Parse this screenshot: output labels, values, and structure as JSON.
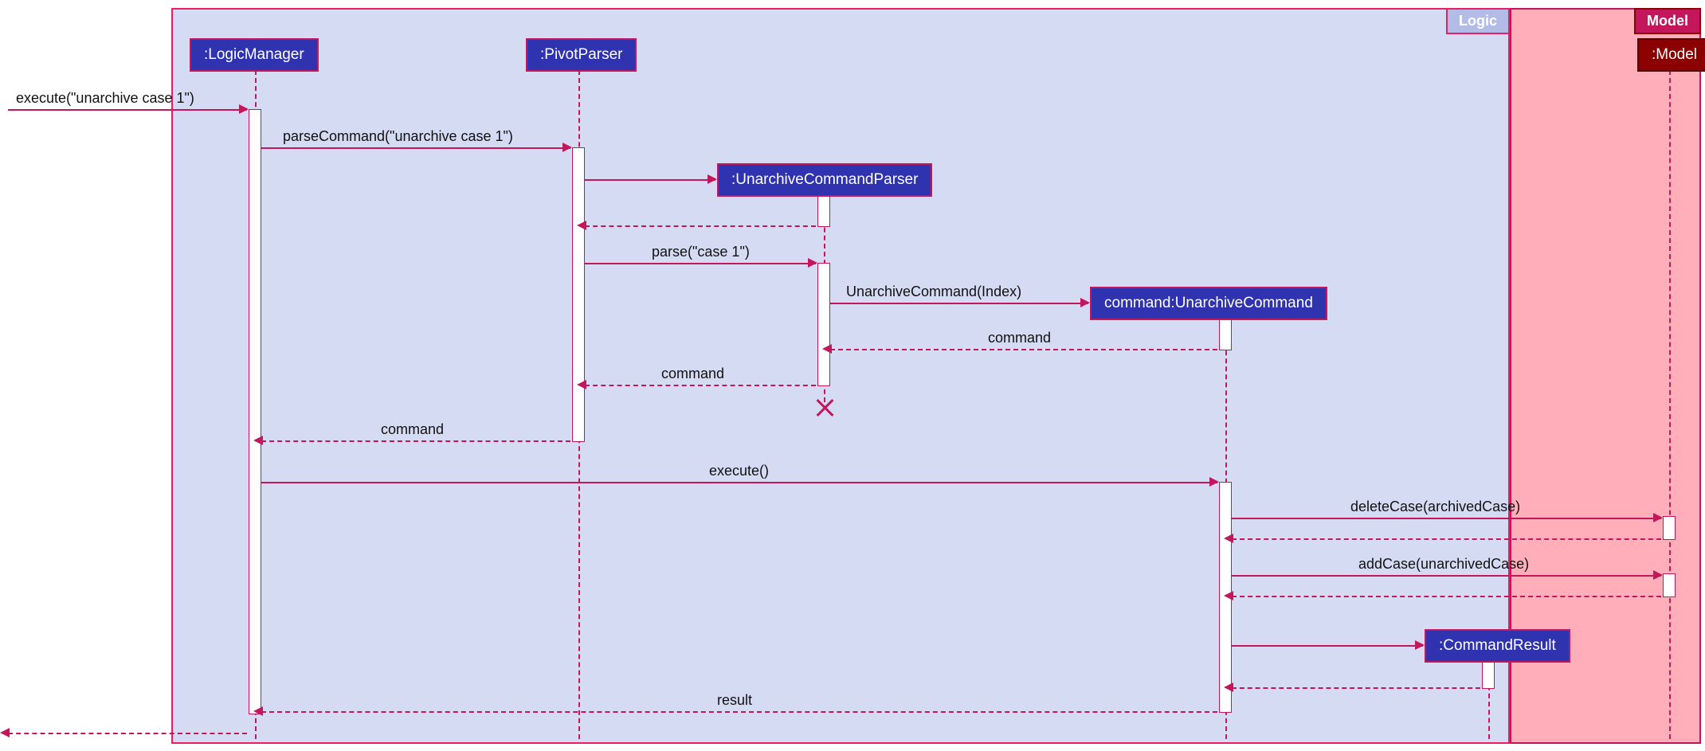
{
  "frames": {
    "logic": "Logic",
    "model": "Model"
  },
  "participants": {
    "logicManager": ":LogicManager",
    "pivotParser": ":PivotParser",
    "unarchiveParser": ":UnarchiveCommandParser",
    "unarchiveCommand": "command:UnarchiveCommand",
    "commandResult": ":CommandResult",
    "model": ":Model"
  },
  "messages": {
    "m1": "execute(\"unarchive case 1\")",
    "m2": "parseCommand(\"unarchive case 1\")",
    "m3": "parse(\"case 1\")",
    "m4": "UnarchiveCommand(Index)",
    "m5": "command",
    "m6": "command",
    "m7": "command",
    "m8": "execute()",
    "m9": "deleteCase(archivedCase)",
    "m10": "addCase(unarchivedCase)",
    "m11": "result"
  }
}
